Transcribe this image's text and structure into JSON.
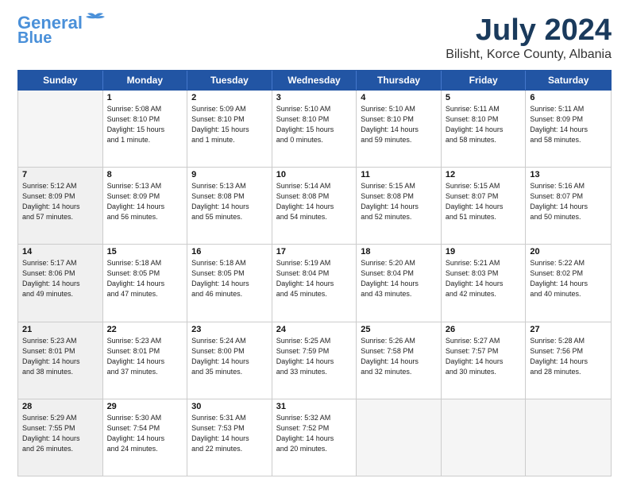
{
  "logo": {
    "line1": "General",
    "line2": "Blue"
  },
  "title": "July 2024",
  "subtitle": "Bilisht, Korce County, Albania",
  "weekdays": [
    "Sunday",
    "Monday",
    "Tuesday",
    "Wednesday",
    "Thursday",
    "Friday",
    "Saturday"
  ],
  "rows": [
    [
      {
        "day": "",
        "info": "",
        "empty": true
      },
      {
        "day": "1",
        "info": "Sunrise: 5:08 AM\nSunset: 8:10 PM\nDaylight: 15 hours\nand 1 minute."
      },
      {
        "day": "2",
        "info": "Sunrise: 5:09 AM\nSunset: 8:10 PM\nDaylight: 15 hours\nand 1 minute."
      },
      {
        "day": "3",
        "info": "Sunrise: 5:10 AM\nSunset: 8:10 PM\nDaylight: 15 hours\nand 0 minutes."
      },
      {
        "day": "4",
        "info": "Sunrise: 5:10 AM\nSunset: 8:10 PM\nDaylight: 14 hours\nand 59 minutes."
      },
      {
        "day": "5",
        "info": "Sunrise: 5:11 AM\nSunset: 8:10 PM\nDaylight: 14 hours\nand 58 minutes."
      },
      {
        "day": "6",
        "info": "Sunrise: 5:11 AM\nSunset: 8:09 PM\nDaylight: 14 hours\nand 58 minutes."
      }
    ],
    [
      {
        "day": "7",
        "info": "Sunrise: 5:12 AM\nSunset: 8:09 PM\nDaylight: 14 hours\nand 57 minutes.",
        "shaded": true
      },
      {
        "day": "8",
        "info": "Sunrise: 5:13 AM\nSunset: 8:09 PM\nDaylight: 14 hours\nand 56 minutes."
      },
      {
        "day": "9",
        "info": "Sunrise: 5:13 AM\nSunset: 8:08 PM\nDaylight: 14 hours\nand 55 minutes."
      },
      {
        "day": "10",
        "info": "Sunrise: 5:14 AM\nSunset: 8:08 PM\nDaylight: 14 hours\nand 54 minutes."
      },
      {
        "day": "11",
        "info": "Sunrise: 5:15 AM\nSunset: 8:08 PM\nDaylight: 14 hours\nand 52 minutes."
      },
      {
        "day": "12",
        "info": "Sunrise: 5:15 AM\nSunset: 8:07 PM\nDaylight: 14 hours\nand 51 minutes."
      },
      {
        "day": "13",
        "info": "Sunrise: 5:16 AM\nSunset: 8:07 PM\nDaylight: 14 hours\nand 50 minutes."
      }
    ],
    [
      {
        "day": "14",
        "info": "Sunrise: 5:17 AM\nSunset: 8:06 PM\nDaylight: 14 hours\nand 49 minutes.",
        "shaded": true
      },
      {
        "day": "15",
        "info": "Sunrise: 5:18 AM\nSunset: 8:05 PM\nDaylight: 14 hours\nand 47 minutes."
      },
      {
        "day": "16",
        "info": "Sunrise: 5:18 AM\nSunset: 8:05 PM\nDaylight: 14 hours\nand 46 minutes."
      },
      {
        "day": "17",
        "info": "Sunrise: 5:19 AM\nSunset: 8:04 PM\nDaylight: 14 hours\nand 45 minutes."
      },
      {
        "day": "18",
        "info": "Sunrise: 5:20 AM\nSunset: 8:04 PM\nDaylight: 14 hours\nand 43 minutes."
      },
      {
        "day": "19",
        "info": "Sunrise: 5:21 AM\nSunset: 8:03 PM\nDaylight: 14 hours\nand 42 minutes."
      },
      {
        "day": "20",
        "info": "Sunrise: 5:22 AM\nSunset: 8:02 PM\nDaylight: 14 hours\nand 40 minutes."
      }
    ],
    [
      {
        "day": "21",
        "info": "Sunrise: 5:23 AM\nSunset: 8:01 PM\nDaylight: 14 hours\nand 38 minutes.",
        "shaded": true
      },
      {
        "day": "22",
        "info": "Sunrise: 5:23 AM\nSunset: 8:01 PM\nDaylight: 14 hours\nand 37 minutes."
      },
      {
        "day": "23",
        "info": "Sunrise: 5:24 AM\nSunset: 8:00 PM\nDaylight: 14 hours\nand 35 minutes."
      },
      {
        "day": "24",
        "info": "Sunrise: 5:25 AM\nSunset: 7:59 PM\nDaylight: 14 hours\nand 33 minutes."
      },
      {
        "day": "25",
        "info": "Sunrise: 5:26 AM\nSunset: 7:58 PM\nDaylight: 14 hours\nand 32 minutes."
      },
      {
        "day": "26",
        "info": "Sunrise: 5:27 AM\nSunset: 7:57 PM\nDaylight: 14 hours\nand 30 minutes."
      },
      {
        "day": "27",
        "info": "Sunrise: 5:28 AM\nSunset: 7:56 PM\nDaylight: 14 hours\nand 28 minutes."
      }
    ],
    [
      {
        "day": "28",
        "info": "Sunrise: 5:29 AM\nSunset: 7:55 PM\nDaylight: 14 hours\nand 26 minutes.",
        "shaded": true
      },
      {
        "day": "29",
        "info": "Sunrise: 5:30 AM\nSunset: 7:54 PM\nDaylight: 14 hours\nand 24 minutes."
      },
      {
        "day": "30",
        "info": "Sunrise: 5:31 AM\nSunset: 7:53 PM\nDaylight: 14 hours\nand 22 minutes."
      },
      {
        "day": "31",
        "info": "Sunrise: 5:32 AM\nSunset: 7:52 PM\nDaylight: 14 hours\nand 20 minutes."
      },
      {
        "day": "",
        "info": "",
        "empty": true
      },
      {
        "day": "",
        "info": "",
        "empty": true
      },
      {
        "day": "",
        "info": "",
        "empty": true
      }
    ]
  ]
}
